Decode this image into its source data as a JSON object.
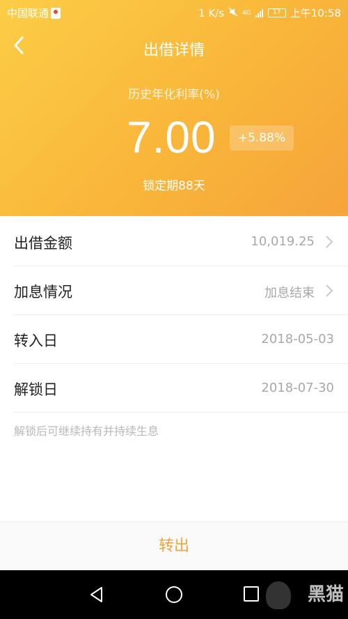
{
  "status_bar": {
    "carrier": "中国联通",
    "speed": "1 K/s",
    "network": "4G",
    "battery": "17",
    "time": "上午10:58"
  },
  "header": {
    "title": "出借详情",
    "rate_label": "历史年化利率(%)",
    "rate_value": "7.00",
    "rate_bonus": "+5.88%",
    "lock_period": "锁定期88天"
  },
  "details": [
    {
      "label": "出借金额",
      "value": "10,019.25"
    },
    {
      "label": "加息情况",
      "value": "加息结束"
    },
    {
      "label": "转入日",
      "value": "2018-05-03"
    },
    {
      "label": "解锁日",
      "value": "2018-07-30"
    }
  ],
  "note": "解锁后可继续持有并持续生息",
  "footer": {
    "action_label": "转出"
  },
  "watermark": {
    "text": "黑猫"
  },
  "colors": {
    "header_gradient_start": "#fccd46",
    "header_gradient_end": "#f6a43b",
    "accent": "#f3a33a"
  }
}
